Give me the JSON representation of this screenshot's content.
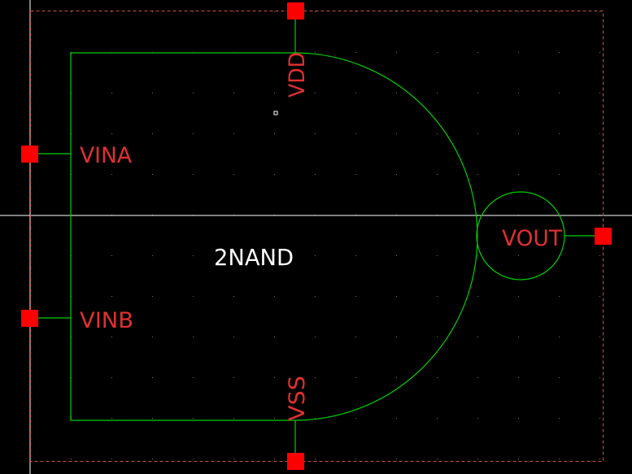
{
  "schematic": {
    "cell_name": "2NAND",
    "pins": {
      "vdd": "VDD",
      "vss": "VSS",
      "vina": "VINA",
      "vinb": "VINB",
      "vout": "VOUT"
    }
  },
  "colors": {
    "background": "#000000",
    "symbol_stroke": "#00d000",
    "pin_square": "#ff0000",
    "pin_label": "#e03030",
    "cell_label": "#ffffff",
    "bounding_box": "#c85050",
    "crosshair": "#ffffff",
    "grid_dot": "#707070"
  }
}
